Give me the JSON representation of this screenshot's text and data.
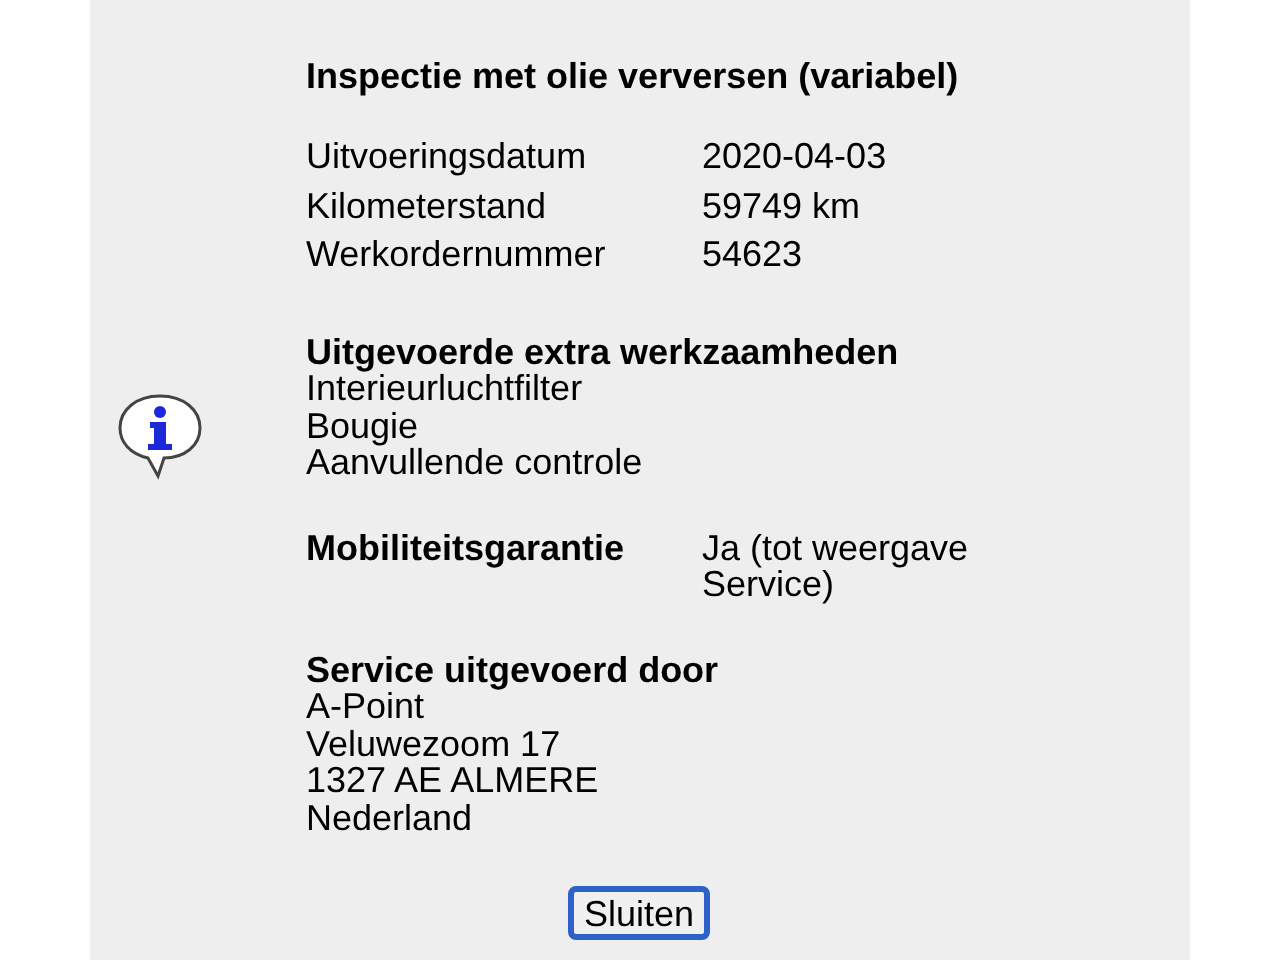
{
  "title": "Inspectie met olie verversen (variabel)",
  "details": [
    {
      "label": "Uitvoeringsdatum",
      "value": "2020-04-03"
    },
    {
      "label": "Kilometerstand",
      "value": "59749 km"
    },
    {
      "label": "Werkordernummer",
      "value": "54623"
    }
  ],
  "extra_work": {
    "heading": "Uitgevoerde extra werkzaamheden",
    "items": [
      "Interieurluchtfilter",
      "Bougie",
      "Aanvullende controle"
    ]
  },
  "mobility": {
    "label": "Mobiliteitsgarantie",
    "value": "Ja (tot weergave Service)"
  },
  "service_by": {
    "heading": "Service uitgevoerd door",
    "lines": [
      "A-Point",
      "Veluwezoom 17",
      "1327 AE ALMERE",
      "Nederland"
    ]
  },
  "close_button": "Sluiten"
}
